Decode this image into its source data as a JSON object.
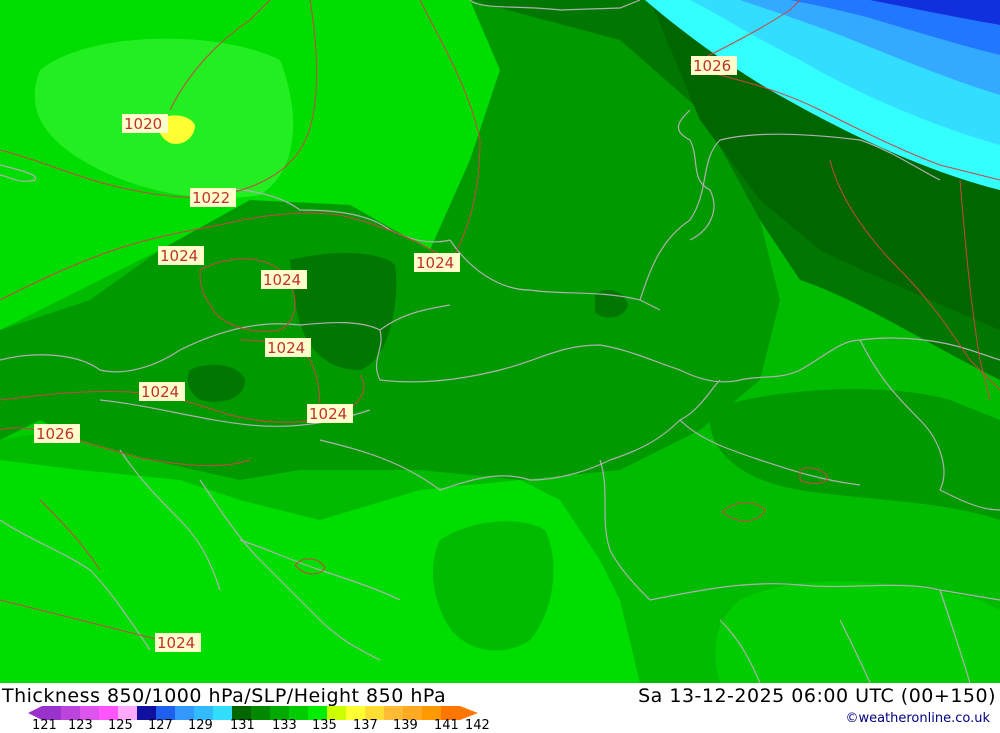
{
  "map": {
    "isobar_labels": [
      "1020",
      "1022",
      "1024",
      "1024",
      "1024",
      "1024",
      "1024",
      "1024",
      "1024",
      "1026",
      "1026"
    ]
  },
  "footer": {
    "title": "Thickness 850/1000 hPa/SLP/Height 850 hPa",
    "datetime": "Sa 13-12-2025 06:00 UTC (00+150)",
    "credit": "©weatheronline.co.uk",
    "legend_ticks": [
      "121",
      "123",
      "125",
      "127",
      "129",
      "131",
      "133",
      "135",
      "137",
      "139",
      "141",
      "142"
    ],
    "legend_colors": [
      "#9933cc",
      "#bb44dd",
      "#dd55ee",
      "#ff55ff",
      "#ffaaff",
      "#1010a0",
      "#2060ee",
      "#3399ff",
      "#33bbff",
      "#33ddff",
      "#006600",
      "#008800",
      "#00aa00",
      "#00cc00",
      "#00ee00",
      "#ccff00",
      "#ffff33",
      "#ffdd33",
      "#ffbb33",
      "#ffaa22",
      "#ff9900",
      "#ff7700"
    ]
  }
}
